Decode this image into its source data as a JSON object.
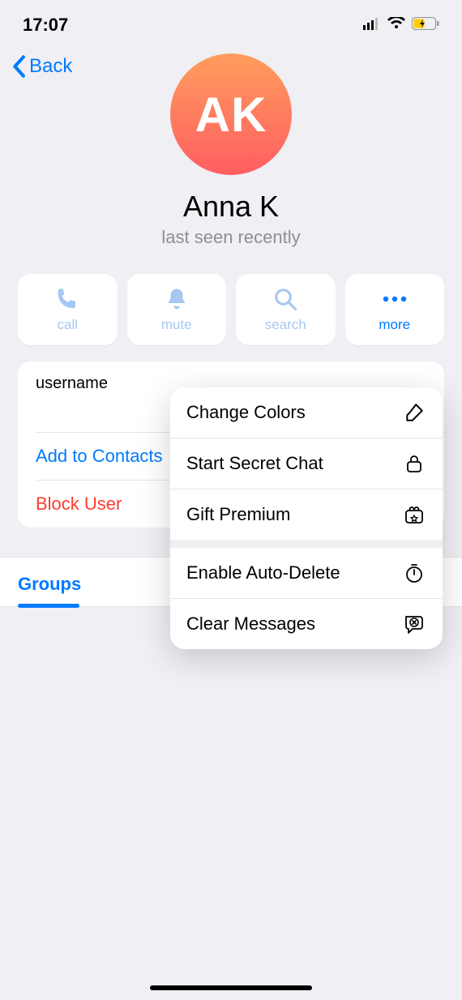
{
  "status": {
    "time": "17:07"
  },
  "nav": {
    "back": "Back"
  },
  "profile": {
    "initials": "AK",
    "name": "Anna K",
    "status": "last seen recently"
  },
  "actions": {
    "call": "call",
    "mute": "mute",
    "search": "search",
    "more": "more"
  },
  "info": {
    "username_label": "username",
    "add_contacts": "Add to Contacts",
    "block_user": "Block User"
  },
  "tabs": {
    "groups": "Groups"
  },
  "popover": {
    "change_colors": "Change Colors",
    "start_secret_chat": "Start Secret Chat",
    "gift_premium": "Gift Premium",
    "enable_auto_delete": "Enable Auto-Delete",
    "clear_messages": "Clear Messages"
  }
}
